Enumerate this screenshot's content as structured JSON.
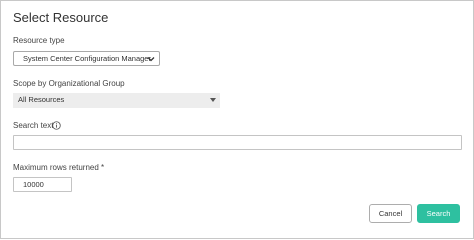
{
  "dialog": {
    "title": "Select Resource"
  },
  "resource_type": {
    "label": "Resource type",
    "selected": "System Center Configuration Manager"
  },
  "scope": {
    "label": "Scope by Organizational Group",
    "selected": "All Resources"
  },
  "search_text": {
    "label": "Search text",
    "value": "",
    "info_icon": "info-circle-icon"
  },
  "max_rows": {
    "label": "Maximum rows returned *",
    "value": "10000"
  },
  "buttons": {
    "cancel_label": "Cancel",
    "search_label": "Search"
  },
  "colors": {
    "accent": "#2ec0a0",
    "grey_select": "#ededed",
    "border": "#c8c8c8"
  }
}
